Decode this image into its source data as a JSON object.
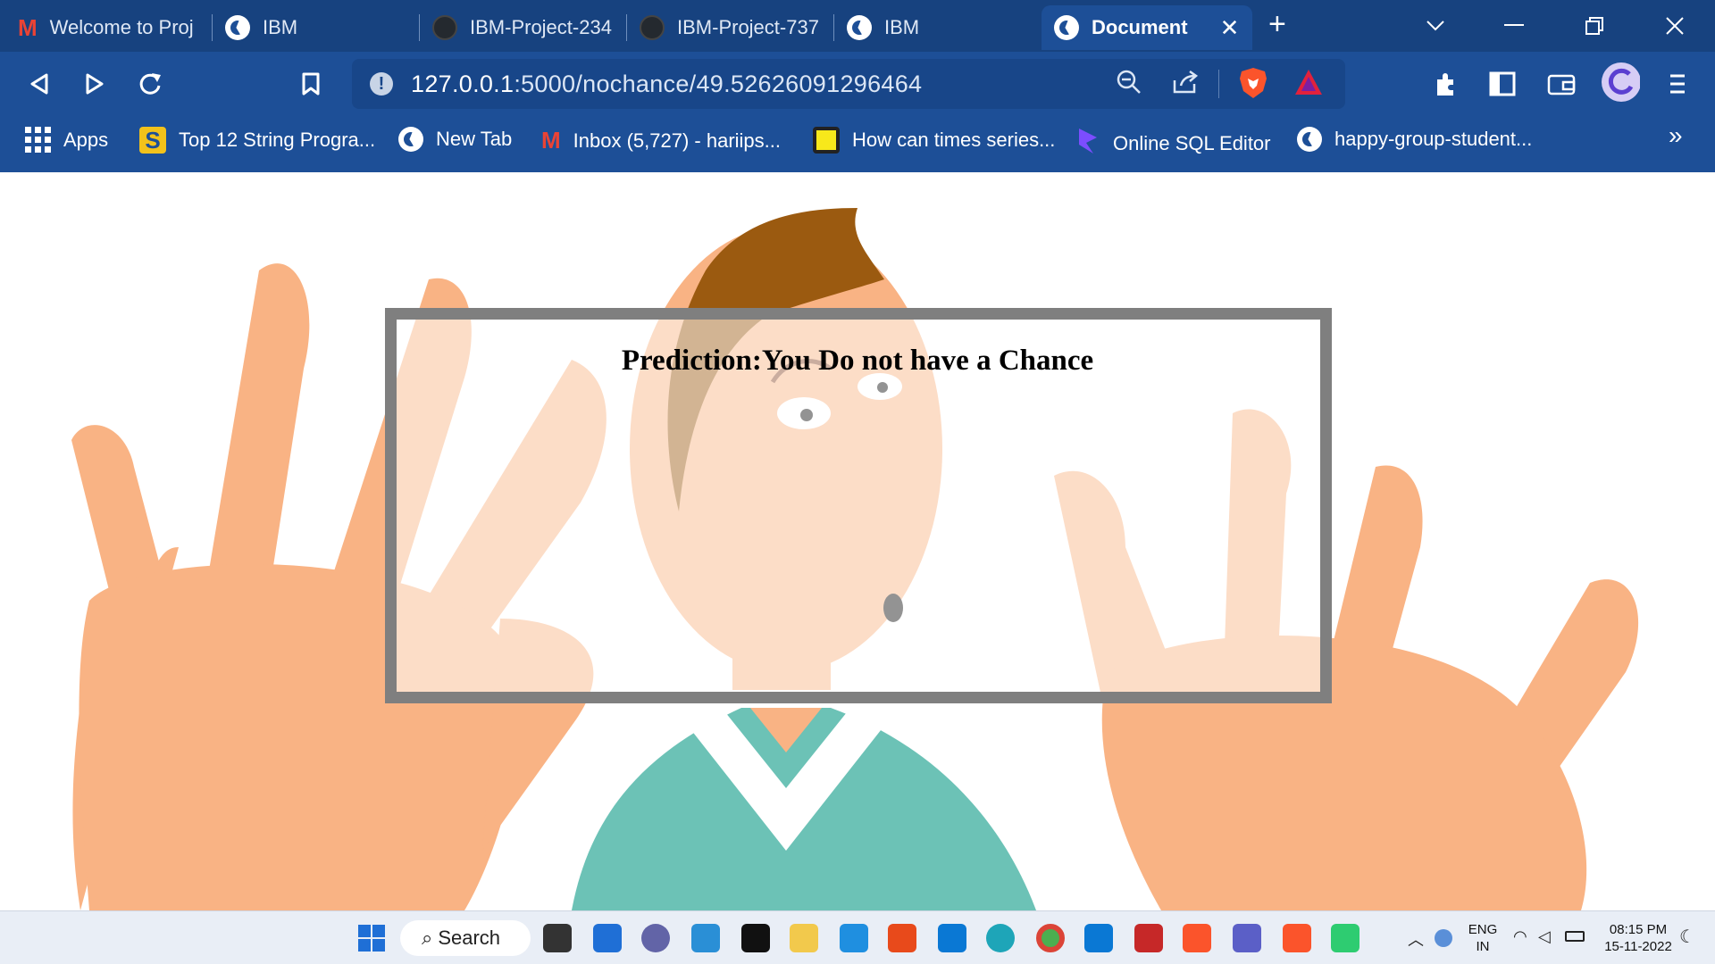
{
  "tabs": [
    {
      "label": "Welcome to Proj",
      "icon": "gmail-icon"
    },
    {
      "label": "IBM",
      "icon": "globe-icon"
    },
    {
      "label": "IBM-Project-234",
      "icon": "github-icon"
    },
    {
      "label": "IBM-Project-737",
      "icon": "github-icon"
    },
    {
      "label": "IBM",
      "icon": "globe-icon"
    },
    {
      "label": "Document",
      "icon": "globe-icon",
      "close": "✕"
    }
  ],
  "url": {
    "host": "127.0.0.1",
    "path": ":5000/nochance/49.52626091296464"
  },
  "bookmarks": [
    {
      "label": "Apps",
      "icon": "apps-grid-icon"
    },
    {
      "label": "Top 12 String Progra...",
      "icon": "s-logo-icon"
    },
    {
      "label": "New Tab",
      "icon": "globe-icon"
    },
    {
      "label": "Inbox (5,727) - hariips...",
      "icon": "gmail-icon"
    },
    {
      "label": "How can times series...",
      "icon": "yellow-square-icon"
    },
    {
      "label": "Online SQL Editor",
      "icon": "sql-editor-icon"
    },
    {
      "label": "happy-group-student...",
      "icon": "globe-icon"
    }
  ],
  "bookmarks_more": "»",
  "page": {
    "prediction": "Prediction:You Do not have a Chance"
  },
  "taskbar": {
    "search_label": "Search"
  },
  "tray": {
    "lang": "ENG",
    "region": "IN",
    "time": "08:15 PM",
    "date": "15-11-2022"
  },
  "colors": {
    "chrome": "#1d4f97",
    "tabstrip": "#17427f",
    "skin": "#f9b384",
    "shirt": "#6cc2b6",
    "hair": "#9b5a10",
    "frame": "#7f7f7f"
  }
}
